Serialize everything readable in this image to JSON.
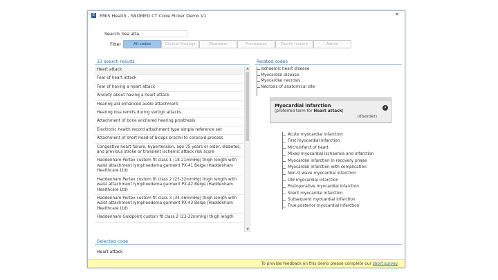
{
  "window": {
    "title": "EMIS Health - SNOMED CT Code Picker Demo V1",
    "close_glyph": "✕",
    "app_icon_glyph": "E"
  },
  "search": {
    "label": "Search",
    "value": "hea atta"
  },
  "filter": {
    "label": "Filter",
    "buttons": [
      {
        "label": "All codes",
        "active": true
      },
      {
        "label": "Clinical findings",
        "active": false
      },
      {
        "label": "Disorders",
        "active": false
      },
      {
        "label": "Procedures",
        "active": false
      },
      {
        "label": "Family history",
        "active": false
      },
      {
        "label": "Admin",
        "active": false
      }
    ]
  },
  "results": {
    "header": "33 search results",
    "items": [
      "Heart attack",
      "Fear of heart attack",
      "Fear of having a heart attack",
      "Anxiety about having a heart attack",
      "Hearing aid enhanced audio attachment",
      "Hearing loss remits during vertigo attacks",
      "Attachment of bone anchored hearing prosthesis",
      "Electronic health record attachment type simple reference set",
      "Attachment of short head of biceps brachii to coracoid process",
      "Congestive heart failure, hypertension, age 75 years or older, diabetes, and previous stroke or transient ischemic attack risk score",
      "Haddenham Pertex custom fit class 1 (18-21mmHg) thigh length with waist attachment lymphoedema garment PX-41 Beige (Haddenham Healthcare Ltd)",
      "Haddenham Pertex custom fit class 2 (23-32mmHg) thigh length with waist attachment lymphoedema garment PX-42 Beige (Haddenham Healthcare Ltd)",
      "Haddenham Pertex custom fit class 3 (34-46mmHg) thigh length with waist attachment lymphoedema garment PX-43 Beige (Haddenham Healthcare Ltd)",
      "Haddenham Goldpoint custom fit class 2 (23-32mmHg) thigh length"
    ]
  },
  "related": {
    "header": "Related codes",
    "parents": [
      "Ischaemic heart disease",
      "Myocardial disease",
      "Myocardial necrosis",
      "Necrosis of anatomical site"
    ],
    "focus": {
      "title": "Myocardial infarction",
      "sub_prefix": "(preferred term for ",
      "sub_term": "Heart attack",
      "sub_suffix": ")",
      "tag": "(disorder)",
      "menu_glyph": "▾"
    },
    "children": [
      "Acute myocardial infarction",
      "First myocardial infarction",
      "Microinfarct of heart",
      "Mixed myocardial ischaemia and infarction",
      "Myocardial infarction in recovery phase",
      "Myocardial infarction with complication",
      "Non-Q wave myocardial infarction",
      "Old myocardial infarction",
      "Postoperative myocardial infarction",
      "Silent myocardial infarction",
      "Subsequent myocardial infarction",
      "True posterior myocardial infarction"
    ]
  },
  "selected": {
    "header": "Selected code",
    "value": "Heart attack"
  },
  "feedback": {
    "text": "To provide feedback on this demo please complete our ",
    "link": "short survey"
  }
}
